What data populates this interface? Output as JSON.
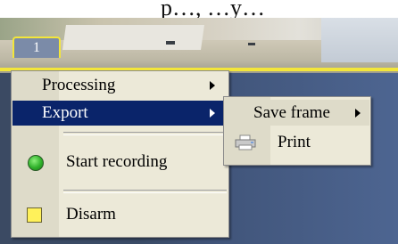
{
  "video": {
    "overlay_tab_label": "1",
    "top_caption": "p…, …y…"
  },
  "context_menu": {
    "items": [
      {
        "label": "Processing",
        "has_submenu": true,
        "highlighted": false
      },
      {
        "label": "Export",
        "has_submenu": true,
        "highlighted": true
      },
      {
        "label": "Start recording",
        "icon": "green-circle-icon",
        "has_submenu": false
      },
      {
        "label": "Disarm",
        "icon": "yellow-square-icon",
        "has_submenu": false
      }
    ]
  },
  "export_submenu": {
    "items": [
      {
        "label": "Save frame",
        "has_submenu": true,
        "hovered": true
      },
      {
        "label": "Print",
        "icon": "printer-icon",
        "has_submenu": false
      }
    ]
  },
  "colors": {
    "highlight": "#0a246a",
    "menu_background": "#ece9d8",
    "overlay_yellow": "#f3e63a"
  }
}
